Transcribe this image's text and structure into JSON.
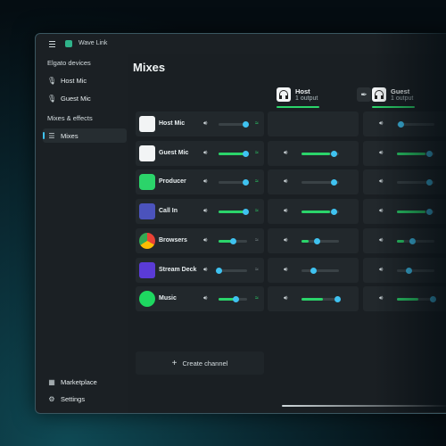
{
  "app": {
    "title": "Wave Link"
  },
  "sidebar": {
    "section1": "Elgato devices",
    "devices": [
      {
        "label": "Host Mic",
        "icon": "mic-icon"
      },
      {
        "label": "Guest Mic",
        "icon": "mic-icon"
      }
    ],
    "section2": "Mixes & effects",
    "mixes_item": {
      "label": "Mixes",
      "icon": "list-icon"
    },
    "bottom": [
      {
        "label": "Marketplace",
        "icon": "marketplace-icon"
      },
      {
        "label": "Settings",
        "icon": "gear-icon"
      }
    ]
  },
  "main": {
    "title": "Mixes"
  },
  "mixes": [
    {
      "name": "Host",
      "sub": "1 output"
    },
    {
      "name": "Guest",
      "sub": "1 output"
    }
  ],
  "channels": [
    {
      "label": "Host Mic",
      "icon": "monitor-icon",
      "level": 0.0,
      "vol": 0.95,
      "effects": true,
      "host": null,
      "guest": 0.1
    },
    {
      "label": "Guest Mic",
      "icon": "monitor-icon",
      "level": 0.9,
      "vol": 0.95,
      "effects": true,
      "host": 0.85,
      "guest": 0.85
    },
    {
      "label": "Producer",
      "icon": "producer-icon",
      "level": 0.0,
      "vol": 0.95,
      "effects": true,
      "host": 0.85,
      "guest": 0.85
    },
    {
      "label": "Call In",
      "icon": "teams-icon",
      "level": 0.9,
      "vol": 0.95,
      "effects": true,
      "host": 0.85,
      "guest": 0.85
    },
    {
      "label": "Browsers",
      "icon": "chrome-icon",
      "level": 0.5,
      "vol": 0.5,
      "effects": false,
      "host": 0.4,
      "guest": 0.4
    },
    {
      "label": "Stream Deck",
      "icon": "stream-deck-icon",
      "level": 0.0,
      "vol": 0.0,
      "effects": false,
      "host": 0.3,
      "guest": 0.3
    },
    {
      "label": "Music",
      "icon": "spotify-icon",
      "level": 0.6,
      "vol": 0.6,
      "effects": true,
      "host": 0.95,
      "guest": 0.95
    }
  ],
  "create_channel": "Create channel",
  "colors": {
    "accent": "#3fc2f0",
    "level": "#2bd46a",
    "panel": "#22282c"
  }
}
